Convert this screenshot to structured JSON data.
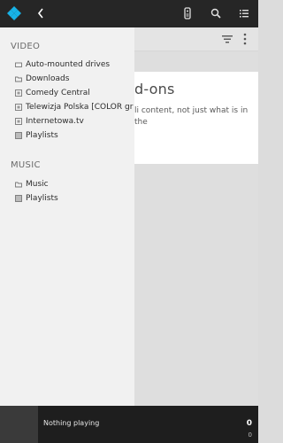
{
  "topbar": {
    "icons": [
      "kodi-logo-icon",
      "back-icon",
      "remote-icon",
      "search-icon",
      "list-icon"
    ]
  },
  "main": {
    "card_title_partial": "d-ons",
    "card_desc_partial": "li content, not just what is in the"
  },
  "drawer": {
    "video_header": "VIDEO",
    "video_items": [
      {
        "label": "Auto-mounted drives",
        "icon": "drive-icon"
      },
      {
        "label": "Downloads",
        "icon": "folder-icon"
      },
      {
        "label": "Comedy Central",
        "icon": "addon-icon"
      },
      {
        "label": "Telewizja Polska [COLOR gr",
        "icon": "addon-icon"
      },
      {
        "label": "Internetowa.tv",
        "icon": "addon-icon"
      },
      {
        "label": "Playlists",
        "icon": "playlist-icon"
      }
    ],
    "music_header": "MUSIC",
    "music_items": [
      {
        "label": "Music",
        "icon": "folder-icon"
      },
      {
        "label": "Playlists",
        "icon": "playlist-icon"
      }
    ]
  },
  "player": {
    "status": "Nothing playing",
    "count_primary": "0",
    "count_secondary": "0"
  }
}
